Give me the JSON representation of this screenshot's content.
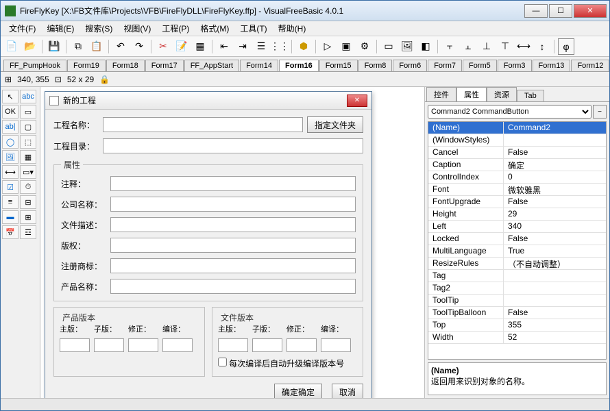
{
  "title": "FireFlyKey [X:\\FB文件库\\Projects\\VFB\\FireFlyDLL\\FireFlyKey.ffp] - VisualFreeBasic 4.0.1",
  "menus": [
    "文件(F)",
    "编辑(E)",
    "搜索(S)",
    "视图(V)",
    "工程(P)",
    "格式(M)",
    "工具(T)",
    "帮助(H)"
  ],
  "status": {
    "pos": "340, 355",
    "size": "52 x 29"
  },
  "tabs": [
    "FF_PumpHook",
    "Form19",
    "Form18",
    "Form17",
    "FF_AppStart",
    "Form14",
    "Form16",
    "Form15",
    "Form8",
    "Form6",
    "Form7",
    "Form5",
    "Form3",
    "Form13",
    "Form12"
  ],
  "active_tab": "Form16",
  "dialog": {
    "title": "新的工程",
    "labels": {
      "proj_name": "工程名称：",
      "proj_dir": "工程目录：",
      "choose_folder": "指定文件夹",
      "attrs": "属性",
      "comment": "注释：",
      "company": "公司名称：",
      "filedesc": "文件描述：",
      "copyright": "版权：",
      "trademark": "注册商标：",
      "product": "产品名称：",
      "prod_ver": "产品版本",
      "file_ver": "文件版本",
      "ver_cols": [
        "主版：",
        "子版：",
        "修正：",
        "编译："
      ],
      "auto_upgrade": "每次编译后自动升级编译版本号",
      "ok": "确定",
      "cancel": "取消"
    }
  },
  "right": {
    "tabs": [
      "控件",
      "属性",
      "资源",
      "Tab"
    ],
    "active": "属性",
    "combo": "Command2 CommandButton",
    "props": [
      {
        "n": "(Name)",
        "v": "Command2",
        "sel": true
      },
      {
        "n": "(WindowStyles)",
        "v": ""
      },
      {
        "n": "Cancel",
        "v": "False"
      },
      {
        "n": "Caption",
        "v": "确定"
      },
      {
        "n": "ControlIndex",
        "v": "0"
      },
      {
        "n": "Font",
        "v": "微软雅黑"
      },
      {
        "n": "FontUpgrade",
        "v": "False"
      },
      {
        "n": "Height",
        "v": "29"
      },
      {
        "n": "Left",
        "v": "340"
      },
      {
        "n": "Locked",
        "v": "False"
      },
      {
        "n": "MultiLanguage",
        "v": "True"
      },
      {
        "n": "ResizeRules",
        "v": "（不自动调整）"
      },
      {
        "n": "Tag",
        "v": ""
      },
      {
        "n": "Tag2",
        "v": ""
      },
      {
        "n": "ToolTip",
        "v": ""
      },
      {
        "n": "ToolTipBalloon",
        "v": "False"
      },
      {
        "n": "Top",
        "v": "355"
      },
      {
        "n": "Width",
        "v": "52"
      }
    ],
    "desc_title": "(Name)",
    "desc_text": "返回用来识别对象的名称。"
  }
}
